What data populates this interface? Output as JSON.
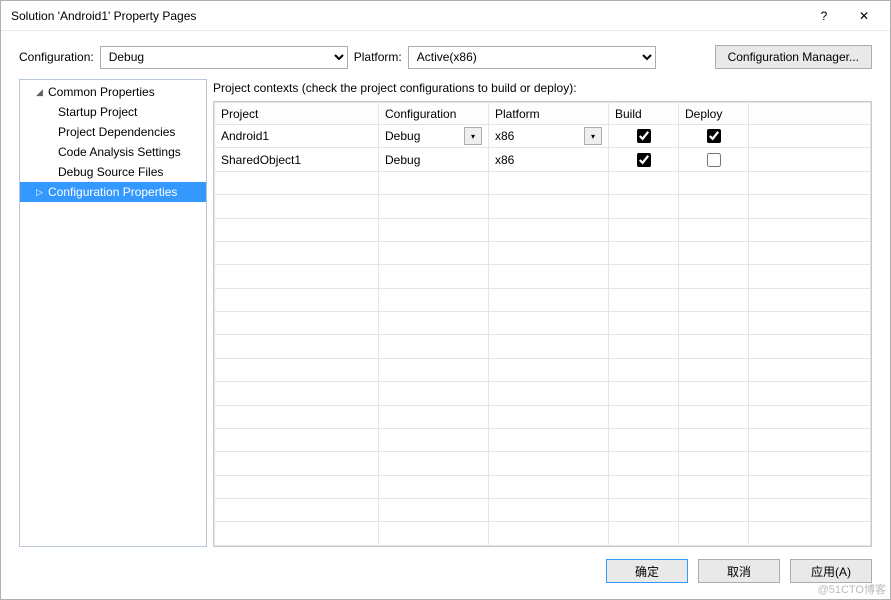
{
  "window": {
    "title": "Solution 'Android1' Property Pages",
    "help_tooltip": "?",
    "close_tooltip": "✕"
  },
  "config_bar": {
    "configuration_label": "Configuration:",
    "configuration_value": "Debug",
    "platform_label": "Platform:",
    "platform_value": "Active(x86)",
    "manager_button": "Configuration Manager..."
  },
  "tree": {
    "common_properties": "Common Properties",
    "startup_project": "Startup Project",
    "project_dependencies": "Project Dependencies",
    "code_analysis_settings": "Code Analysis Settings",
    "debug_source_files": "Debug Source Files",
    "configuration_properties": "Configuration Properties"
  },
  "right": {
    "section_title": "Project contexts (check the project configurations to build or deploy):",
    "columns": {
      "project": "Project",
      "configuration": "Configuration",
      "platform": "Platform",
      "build": "Build",
      "deploy": "Deploy"
    },
    "rows": [
      {
        "project": "Android1",
        "configuration": "Debug",
        "platform": "x86",
        "build": true,
        "deploy": true,
        "cfg_dropdown": true,
        "plat_dropdown": true
      },
      {
        "project": "SharedObject1",
        "configuration": "Debug",
        "platform": "x86",
        "build": true,
        "deploy": false,
        "cfg_dropdown": false,
        "plat_dropdown": false
      }
    ]
  },
  "footer": {
    "ok": "确定",
    "cancel": "取消",
    "apply": "应用(A)"
  },
  "watermark": "@51CTO博客"
}
